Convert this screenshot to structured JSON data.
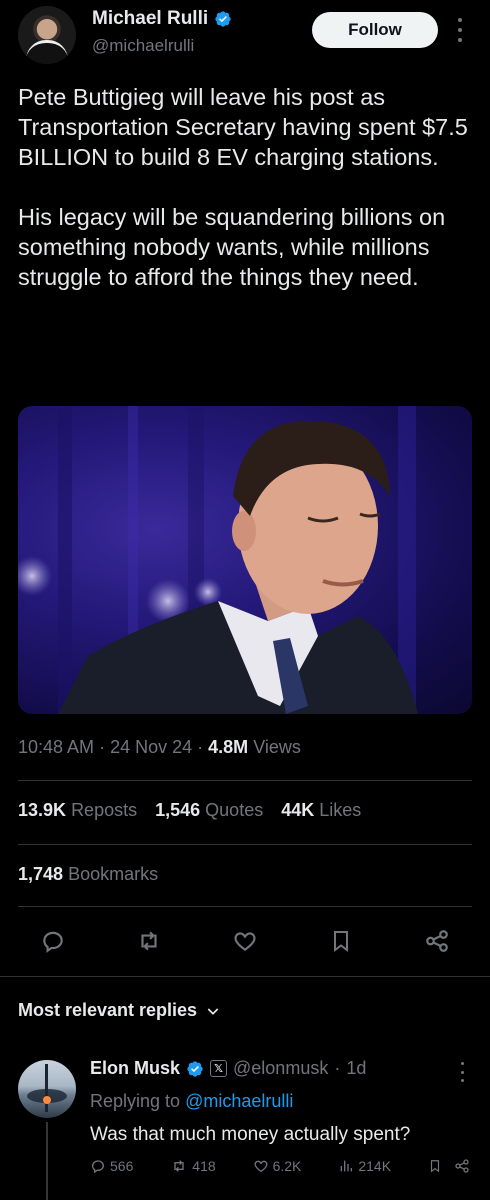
{
  "tweet": {
    "author_name": "Michael Rulli",
    "author_handle": "@michaelrulli",
    "follow_label": "Follow",
    "text": "Pete Buttigieg will leave his post as Transportation Secretary having spent $7.5 BILLION to build 8 EV charging stations.\n\nHis legacy will be squandering billions on something nobody wants, while millions struggle to afford the things they need.",
    "time": "10:48 AM",
    "date": "24 Nov 24",
    "views_count": "4.8M",
    "views_label": "Views",
    "reposts_count": "13.9K",
    "reposts_label": "Reposts",
    "quotes_count": "1,546",
    "quotes_label": "Quotes",
    "likes_count": "44K",
    "likes_label": "Likes",
    "bookmarks_count": "1,748",
    "bookmarks_label": "Bookmarks"
  },
  "replies_section": {
    "label": "Most relevant replies"
  },
  "reply": {
    "author_name": "Elon Musk",
    "author_handle": "@elonmusk",
    "age": "1d",
    "replying_prefix": "Replying to",
    "replying_handle": "@michaelrulli",
    "text": "Was that much money actually spent?",
    "replies": "566",
    "reposts": "418",
    "likes": "6.2K",
    "views": "214K"
  },
  "colors": {
    "background": "#000000",
    "text": "#e7e9ea",
    "muted": "#71767b",
    "accent": "#1d9bf0",
    "divider": "#2f3336"
  },
  "icons": [
    "verified-icon",
    "more-icon",
    "reply-icon",
    "repost-icon",
    "like-icon",
    "bookmark-icon",
    "share-icon",
    "chevron-down-icon",
    "views-icon",
    "x-logo-icon"
  ]
}
